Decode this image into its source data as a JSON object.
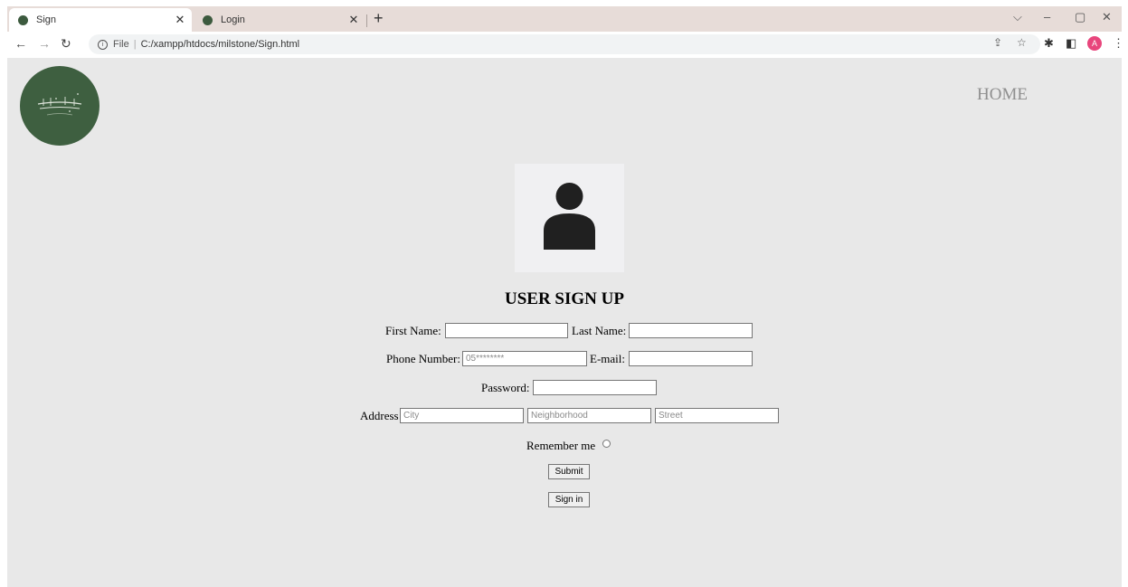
{
  "browser": {
    "tabs": [
      {
        "label": "Sign",
        "active": true
      },
      {
        "label": "Login",
        "active": false
      }
    ],
    "url": {
      "scheme": "File",
      "path": "C:/xampp/htdocs/milstone/Sign.html"
    },
    "profile_initial": "A"
  },
  "nav": {
    "home": "HOME"
  },
  "form": {
    "title": "USER SIGN UP",
    "first_name_label": "First Name:",
    "last_name_label": "Last Name:",
    "phone_label": "Phone Number:",
    "phone_placeholder": "05********",
    "email_label": "E-mail:",
    "password_label": "Password:",
    "address_label": "Address",
    "city_placeholder": "City",
    "neighborhood_placeholder": "Neighborhood",
    "street_placeholder": "Street",
    "remember_label": "Remember me",
    "submit_label": "Submit",
    "signin_label": "Sign in"
  },
  "colors": {
    "logo_bg": "#3e5f40",
    "page_bg": "#e8e8e8",
    "tabbar_bg": "#e7dcd8"
  }
}
